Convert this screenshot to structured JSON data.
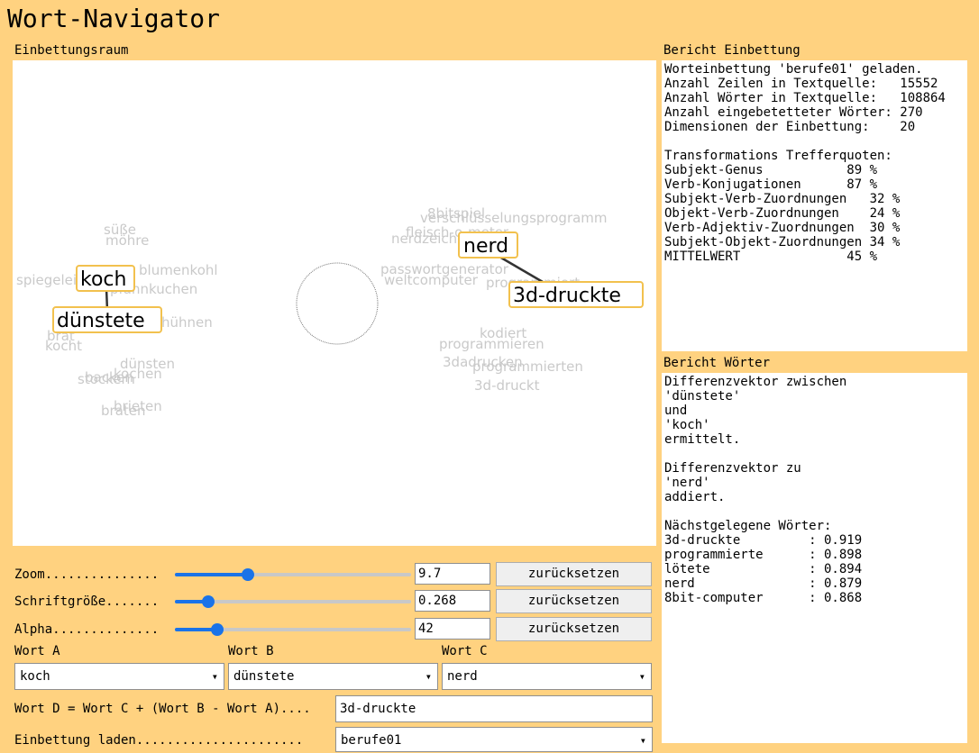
{
  "app": {
    "title": "Wort-Navigator"
  },
  "panels": {
    "space_label": "Einbettungsraum",
    "report_embedding_label": "Bericht Einbettung",
    "report_words_label": "Bericht Wörter"
  },
  "canvas": {
    "highlight_words": [
      "koch",
      "dünstete",
      "nerd",
      "3d-druckte"
    ],
    "faded_words": [
      "süße",
      "möhre",
      "spiegelei",
      "blumenkohl",
      "pfannkuchen",
      "hühnen",
      "brät",
      "kocht",
      "dünsten",
      "kochen",
      "stockern",
      "backen",
      "braten",
      "brieten",
      "8bitspiel",
      "verschlüsselungsprogramm",
      "fleisch-o-meter",
      "nerdzeichen",
      "passwortgenerator",
      "weltcomputer",
      "programmiert",
      "programmieren",
      "3dadrucken",
      "programmierten",
      "3d-druckt",
      "kodiert"
    ]
  },
  "controls": {
    "zoom": {
      "label": "Zoom...............",
      "value": "9.7",
      "reset": "zurücksetzen",
      "level": 0.31
    },
    "font": {
      "label": "Schriftgröße.......",
      "value": "0.268",
      "reset": "zurücksetzen",
      "level": 0.14
    },
    "alpha": {
      "label": "Alpha..............",
      "value": "42",
      "reset": "zurücksetzen",
      "level": 0.18
    }
  },
  "words": {
    "a_label": "Wort A",
    "a_value": "koch",
    "b_label": "Wort B",
    "b_value": "dünstete",
    "c_label": "Wort C",
    "c_value": "nerd",
    "d_label": "Wort D = Wort C + (Wort B - Wort A)....",
    "d_value": "3d-druckte",
    "load_label": "Einbettung laden......................",
    "load_value": "berufe01"
  },
  "report_embedding": "Worteinbettung 'berufe01' geladen.\nAnzahl Zeilen in Textquelle:   15552\nAnzahl Wörter in Textquelle:   108864\nAnzahl eingebetetteter Wörter: 270\nDimensionen der Einbettung:    20\n\nTransformations Trefferquoten:\nSubjekt-Genus           89 %\nVerb-Konjugationen      87 %\nSubjekt-Verb-Zuordnungen   32 %\nObjekt-Verb-Zuordnungen    24 %\nVerb-Adjektiv-Zuordnungen  30 %\nSubjekt-Objekt-Zuordnungen 34 %\nMITTELWERT              45 %",
  "report_words": "Differenzvektor zwischen\n'dünstete'\nund\n'koch'\nermittelt.\n\nDifferenzvektor zu\n'nerd'\naddiert.\n\nNächstgelegene Wörter:\n3d-druckte         : 0.919\nprogrammierte      : 0.898\nlötete             : 0.894\nnerd               : 0.879\n8bit-computer      : 0.868",
  "icons": {
    "dropdown": "chevron-down-icon"
  }
}
